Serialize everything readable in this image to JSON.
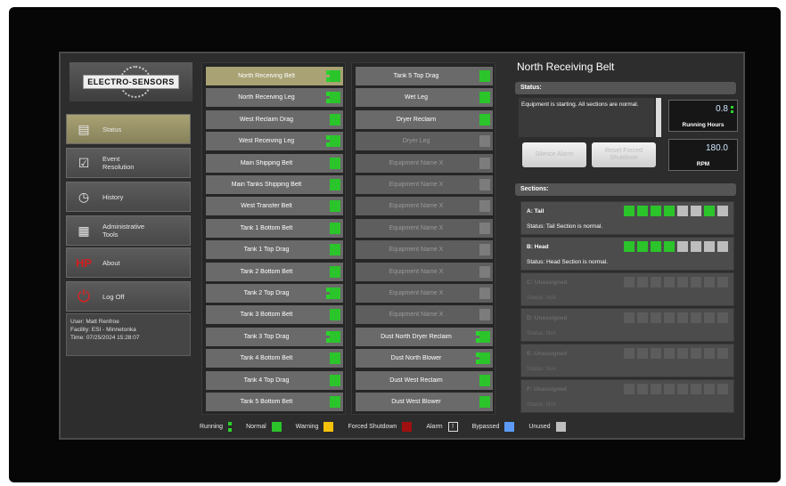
{
  "brand": {
    "logo_text": "ELECTRO-SENSORS"
  },
  "nav": [
    {
      "label": "Status",
      "icon": "status-list-icon",
      "active": true
    },
    {
      "label": "Event\nResolution",
      "icon": "checklist-icon"
    },
    {
      "label": "History",
      "icon": "clock-icon"
    },
    {
      "label": "Administrative\nTools",
      "icon": "admin-tools-icon"
    },
    {
      "label": "About",
      "icon": "hp-logo-icon"
    },
    {
      "label": "Log Off",
      "icon": "power-icon"
    }
  ],
  "user_info": {
    "user": "User: Matt Renfroe",
    "facility": "Facility: ESI - Minnetonka",
    "time": "Time: 07/25/2024 15:28:07"
  },
  "equipment_left": [
    {
      "name": "North Receiving Belt",
      "running": true,
      "status": "normal",
      "selected": true
    },
    {
      "name": "North Receiving Leg",
      "running": true,
      "status": "normal"
    },
    {
      "name": "West Reclaim Drag",
      "running": false,
      "status": "normal"
    },
    {
      "name": "West Receiving Leg",
      "running": true,
      "status": "normal"
    },
    {
      "name": "Main Shipping Belt",
      "running": false,
      "status": "normal"
    },
    {
      "name": "Main Tanks Shipping Belt",
      "running": false,
      "status": "normal"
    },
    {
      "name": "West Transfer Belt",
      "running": false,
      "status": "normal"
    },
    {
      "name": "Tank 1 Bottom Belt",
      "running": false,
      "status": "normal"
    },
    {
      "name": "Tank 1 Top Drag",
      "running": false,
      "status": "normal"
    },
    {
      "name": "Tank 2 Bottom Belt",
      "running": false,
      "status": "normal"
    },
    {
      "name": "Tank 2 Top Drag",
      "running": true,
      "status": "normal"
    },
    {
      "name": "Tank 3 Bottom Belt",
      "running": false,
      "status": "normal"
    },
    {
      "name": "Tank 3 Top Drag",
      "running": true,
      "status": "normal"
    },
    {
      "name": "Tank 4 Bottom Belt",
      "running": false,
      "status": "normal"
    },
    {
      "name": "Tank 4 Top Drag",
      "running": false,
      "status": "normal"
    },
    {
      "name": "Tank 5 Bottom Belt",
      "running": false,
      "status": "normal"
    }
  ],
  "equipment_right": [
    {
      "name": "Tank 5 Top Drag",
      "running": false,
      "status": "normal"
    },
    {
      "name": "Wet Leg",
      "running": false,
      "status": "normal"
    },
    {
      "name": "Dryer Reclaim",
      "running": false,
      "status": "normal"
    },
    {
      "name": "Dryer Leg",
      "running": false,
      "status": "unused",
      "disabled": true
    },
    {
      "name": "Equipment Name X",
      "running": false,
      "status": "unused",
      "disabled": true
    },
    {
      "name": "Equipment Name X",
      "running": false,
      "status": "unused",
      "disabled": true
    },
    {
      "name": "Equipment Name X",
      "running": false,
      "status": "unused",
      "disabled": true
    },
    {
      "name": "Equipment Name X",
      "running": false,
      "status": "unused",
      "disabled": true
    },
    {
      "name": "Equipment Name X",
      "running": false,
      "status": "unused",
      "disabled": true
    },
    {
      "name": "Equipment Name X",
      "running": false,
      "status": "unused",
      "disabled": true
    },
    {
      "name": "Equipment Name X",
      "running": false,
      "status": "unused",
      "disabled": true
    },
    {
      "name": "Equipment Name X",
      "running": false,
      "status": "unused",
      "disabled": true
    },
    {
      "name": "Dust North Dryer Reclaim",
      "running": true,
      "status": "normal"
    },
    {
      "name": "Dust North Blower",
      "running": true,
      "status": "normal"
    },
    {
      "name": "Dust West Reclaim",
      "running": false,
      "status": "normal"
    },
    {
      "name": "Dust West Blower",
      "running": false,
      "status": "normal"
    }
  ],
  "legend": {
    "running": "Running",
    "normal": "Normal",
    "warning": "Warning",
    "forced_shutdown": "Forced Shutdown",
    "alarm": "Alarm",
    "alarm_symbol": "!",
    "bypassed": "Bypassed",
    "unused": "Unused"
  },
  "colors": {
    "normal": "#2bc42b",
    "warning": "#f5c20b",
    "forced_shutdown": "#a01010",
    "bypassed": "#5b9bf5",
    "unused": "#bdbdbd",
    "selected": "#a8a274"
  },
  "detail": {
    "title": "North Receiving Belt",
    "status_label": "Status:",
    "status_message": "Equipment is starting. All sections are normal.",
    "running_hours_value": "0.8",
    "running_hours_label": "Running Hours",
    "rpm_value": "180.0",
    "rpm_label": "RPM",
    "silence_alarm": "Silence Alarm",
    "reset_forced_shutdown": "Reset Forced\nShutdown",
    "sections_label": "Sections:",
    "sections": [
      {
        "name": "A: Tail",
        "status": "Status: Tail Section is normal.",
        "cells": [
          "n",
          "n",
          "n",
          "n",
          "u",
          "u",
          "n",
          "u"
        ],
        "assigned": true
      },
      {
        "name": "B: Head",
        "status": "Status: Head Section is normal.",
        "cells": [
          "n",
          "n",
          "n",
          "n",
          "u",
          "u",
          "u",
          "u"
        ],
        "assigned": true
      },
      {
        "name": "C: Unassigned",
        "status": "Status: N/A",
        "cells": [
          "x",
          "x",
          "x",
          "x",
          "x",
          "x",
          "x",
          "x"
        ],
        "assigned": false
      },
      {
        "name": "D: Unassigned",
        "status": "Status: N/A",
        "cells": [
          "x",
          "x",
          "x",
          "x",
          "x",
          "x",
          "x",
          "x"
        ],
        "assigned": false
      },
      {
        "name": "E: Unassigned",
        "status": "Status: N/A",
        "cells": [
          "x",
          "x",
          "x",
          "x",
          "x",
          "x",
          "x",
          "x"
        ],
        "assigned": false
      },
      {
        "name": "F: Unassigned",
        "status": "Status: N/A",
        "cells": [
          "x",
          "x",
          "x",
          "x",
          "x",
          "x",
          "x",
          "x"
        ],
        "assigned": false
      }
    ]
  }
}
